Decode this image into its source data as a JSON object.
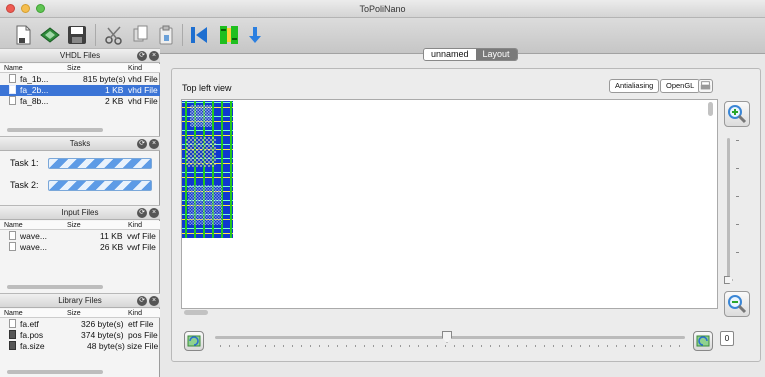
{
  "window": {
    "title": "ToPoliNano"
  },
  "toolbar": {
    "icons": [
      "new-file-icon",
      "open-layout-icon",
      "save-icon",
      "cut-icon",
      "copy-icon",
      "paste-icon",
      "first-icon",
      "run-icon",
      "download-icon"
    ]
  },
  "vhdl_panel": {
    "title": "VHDL Files",
    "columns": {
      "name": "Name",
      "size": "Size",
      "kind": "Kind"
    },
    "files": [
      {
        "name": "fa_1b...",
        "size": "815 byte(s)",
        "kind": "vhd File",
        "selected": false
      },
      {
        "name": "fa_2b...",
        "size": "1 KB",
        "kind": "vhd File",
        "selected": true
      },
      {
        "name": "fa_8b...",
        "size": "2 KB",
        "kind": "vhd File",
        "selected": false
      }
    ]
  },
  "tasks_panel": {
    "title": "Tasks",
    "tasks": [
      {
        "label": "Task 1:"
      },
      {
        "label": "Task 2:"
      }
    ]
  },
  "input_panel": {
    "title": "Input Files",
    "columns": {
      "name": "Name",
      "size": "Size",
      "kind": "Kind"
    },
    "files": [
      {
        "name": "wave...",
        "size": "11 KB",
        "kind": "vwf File"
      },
      {
        "name": "wave...",
        "size": "26 KB",
        "kind": "vwf File"
      }
    ]
  },
  "library_panel": {
    "title": "Library Files",
    "columns": {
      "name": "Name",
      "size": "Size",
      "kind": "Kind"
    },
    "files": [
      {
        "name": "fa.etf",
        "size": "326 byte(s)",
        "kind": "etf File"
      },
      {
        "name": "fa.pos",
        "size": "374 byte(s)",
        "kind": "pos File"
      },
      {
        "name": "fa.size",
        "size": "48 byte(s)",
        "kind": "size File"
      }
    ]
  },
  "tabs": [
    {
      "label": "unnamed",
      "active": false
    },
    {
      "label": "Layout",
      "active": true
    }
  ],
  "view": {
    "label": "Top left view",
    "antialiasing_label": "Antialiasing",
    "opengl_label": "OpenGL",
    "zoom_value": "0",
    "colors": {
      "substrate": "#1038d0",
      "wire": "#22c81e",
      "accent": "#ffe64a"
    }
  }
}
